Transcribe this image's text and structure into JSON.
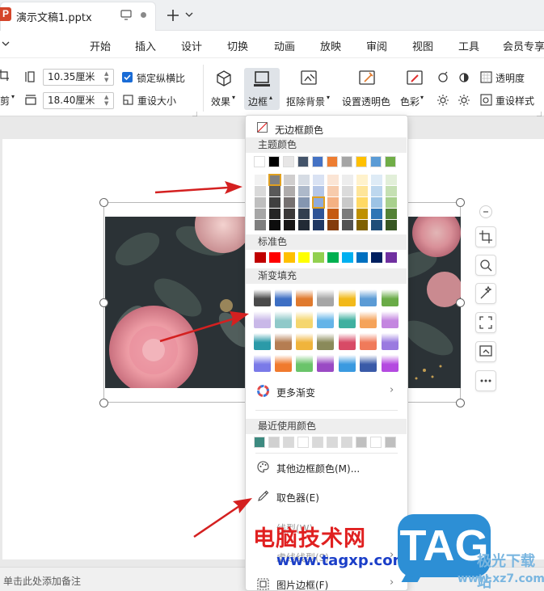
{
  "titlebar": {
    "app_badge": "P",
    "doc_name": "演示文稿1.pptx"
  },
  "menu": [
    "开始",
    "插入",
    "设计",
    "切换",
    "动画",
    "放映",
    "审阅",
    "视图",
    "工具",
    "会员专享"
  ],
  "ribbon": {
    "crop_label": "剪",
    "width_value": "10.35厘米",
    "height_value": "18.40厘米",
    "lock_ratio": "锁定纵横比",
    "reset_size": "重设大小",
    "effects": "效果",
    "border": "边框",
    "remove_bg": "抠除背景",
    "set_transparent": "设置透明色",
    "color": "色彩",
    "transparency": "透明度",
    "reset_style": "重设样式"
  },
  "dropdown": {
    "no_border": "无边框颜色",
    "theme_colors_title": "主题颜色",
    "standard_title": "标准色",
    "gradient_title": "渐变填充",
    "more_gradient": "更多渐变",
    "recent_title": "最近使用颜色",
    "other_colors": "其他边框颜色(M)...",
    "eyedropper": "取色器(E)",
    "line_weight": "线型(W)",
    "dash_type": "虚线线型(S)",
    "picture_border": "图片边框(F)",
    "theme_top": [
      "#ffffff",
      "#000000",
      "#e7e6e6",
      "#44546a",
      "#4472c4",
      "#ed7d31",
      "#a5a5a5",
      "#ffc000",
      "#5b9bd5",
      "#70ad47"
    ],
    "theme_shades": [
      [
        "#f2f2f2",
        "#808080",
        "#d0cece",
        "#d6dce4",
        "#d9e2f3",
        "#fbe5d5",
        "#ededed",
        "#fff2cc",
        "#deebf6",
        "#e2efd9"
      ],
      [
        "#d9d9d9",
        "#595959",
        "#aeabab",
        "#adb9ca",
        "#b4c6e7",
        "#f7cbac",
        "#dbdbdb",
        "#fee599",
        "#bdd7ee",
        "#c5e0b3"
      ],
      [
        "#bfbfbf",
        "#404040",
        "#757070",
        "#8496b0",
        "#8eaadb",
        "#f4b183",
        "#c9c9c9",
        "#ffd965",
        "#9cc3e5",
        "#a8d08d"
      ],
      [
        "#a6a6a6",
        "#262626",
        "#3a3838",
        "#323f4f",
        "#2f5496",
        "#c55a11",
        "#7b7b7b",
        "#bf9000",
        "#2e75b5",
        "#538135"
      ],
      [
        "#7f7f7f",
        "#0d0d0d",
        "#171616",
        "#222a35",
        "#1f3864",
        "#843c0c",
        "#525252",
        "#7f6000",
        "#1e4e79",
        "#375623"
      ]
    ],
    "standard": [
      "#c00000",
      "#ff0000",
      "#ffc000",
      "#ffff00",
      "#92d050",
      "#00b050",
      "#00b0f0",
      "#0070c0",
      "#002060",
      "#7030a0"
    ],
    "gradients": [
      [
        "#4a4a4a",
        "#3d6fc4",
        "#e07a2e",
        "#a6a6a6",
        "#f2b91a",
        "#5b9bd5",
        "#6aab47"
      ],
      [
        "#c9b8e8",
        "#8fc9c9",
        "#f5d66e",
        "#64b4e8",
        "#3fb0a0",
        "#f5a35a",
        "#c486e0"
      ],
      [
        "#2b9aa8",
        "#b57d52",
        "#f0b43c",
        "#8a8a5a",
        "#d84a66",
        "#f07a5a",
        "#9a7ae0"
      ],
      [
        "#7a7ae8",
        "#f07a2e",
        "#6ac46a",
        "#9a4ac4",
        "#3a9ae0",
        "#3a5aa8",
        "#b44ae0"
      ]
    ],
    "recent": [
      "#3d8a80",
      "#d0d0d0",
      "#d9d9d9",
      "#ffffff",
      "#d9d9d9",
      "#d9d9d9",
      "#d9d9d9",
      "#c0c0c0",
      "#ffffff",
      "#bfbfbf"
    ]
  },
  "status": {
    "notes": "单击此处添加备注"
  },
  "watermark": {
    "cn": "电脑技术网",
    "url": "www.tagxp.com",
    "tag": "TAG",
    "site2": "极光下载站",
    "url2": "www.xz7.com"
  }
}
